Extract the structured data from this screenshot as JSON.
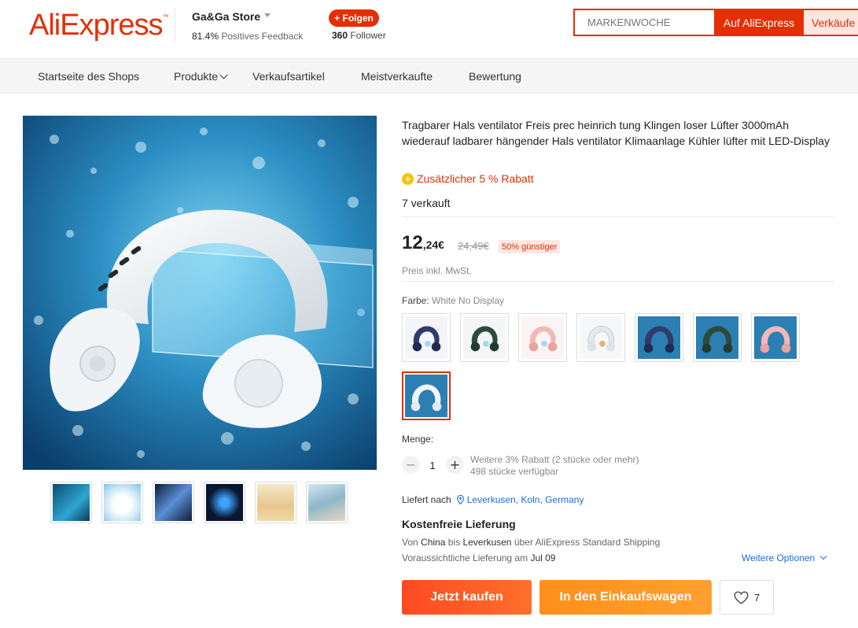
{
  "header": {
    "logo": "AliExpress",
    "store_name": "Ga&Ga Store",
    "feedback_percent": "81.4%",
    "feedback_label": "Positives Feedback",
    "follow_label": "+ Folgen",
    "follower_count": "360",
    "follower_label": "Follower",
    "search_placeholder": "MARKENWOCHE",
    "search_ali_label": "Auf AliExpress",
    "search_store_label": "Verkäufe"
  },
  "nav": {
    "items": [
      "Startseite des Shops",
      "Produkte",
      "Verkaufsartikel",
      "Meistverkaufte",
      "Bewertung"
    ]
  },
  "product": {
    "title": "Tragbarer Hals ventilator Freis prec heinrich tung Klingen loser Lüfter 3000mAh wiederauf ladbarer hängender Hals ventilator Klimaanlage Kühler lüfter mit LED-Display",
    "extra_discount": "Zusätzlicher 5 % Rabatt",
    "sold": "7 verkauft",
    "price_int": "12",
    "price_frac": ",24€",
    "old_price": "24,49€",
    "discount_badge": "50% günstiger",
    "tax_note": "Preis inkl. MwSt.",
    "color_label": "Farbe:",
    "color_value": "White No Display",
    "swatches": [
      {
        "icon": "navy-fan"
      },
      {
        "icon": "green-fan"
      },
      {
        "icon": "pink-fan"
      },
      {
        "icon": "white-fan"
      },
      {
        "icon": "navy-fan-scene"
      },
      {
        "icon": "green-fan-scene"
      },
      {
        "icon": "pink-fan-scene"
      },
      {
        "icon": "white-fan-scene"
      }
    ],
    "selected_swatch": 7,
    "quantity_label": "Menge:",
    "quantity": "1",
    "qty_discount": "Weitere 3% Rabatt (2 stücke oder mehr)",
    "qty_available": "498 stücke verfügbar"
  },
  "shipping": {
    "to_label": "Liefert nach",
    "location": "Leverkusen, Koln, Germany",
    "title": "Kostenfreie Lieferung",
    "desc_prefix": "Von",
    "from": "China",
    "desc_mid": "bis",
    "to": "Leverkusen",
    "desc_suffix": "über AliExpress Standard Shipping",
    "eta_label": "Voraussichtliche Lieferung am",
    "eta_date": "Jul 09",
    "more_options": "Weitere Optionen"
  },
  "actions": {
    "buy_now": "Jetzt kaufen",
    "add_to_cart": "In den Einkaufswagen",
    "wishlist_count": "7"
  },
  "colors": {
    "brand": "#e62e04",
    "buy_gradient": "#ff4a22",
    "cart_gradient": "#ff8f1a",
    "link": "#1a6ee0"
  }
}
